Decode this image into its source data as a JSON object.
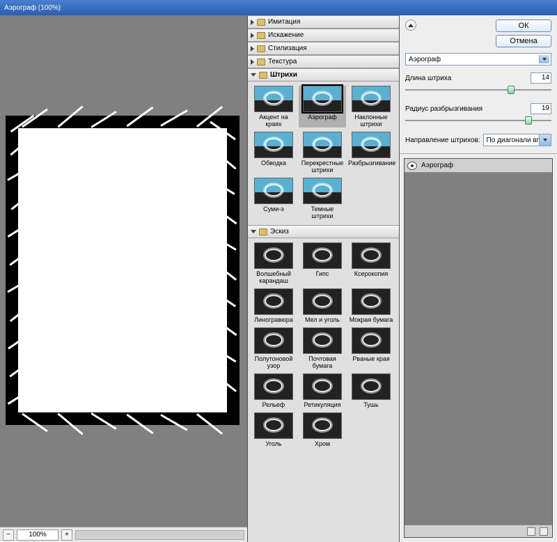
{
  "window": {
    "title": "Аэрограф (100%)"
  },
  "zoom": {
    "minus": "−",
    "value": "100%",
    "plus": "+"
  },
  "categories": [
    {
      "label": "Имитация",
      "open": false
    },
    {
      "label": "Искажение",
      "open": false
    },
    {
      "label": "Стилизация",
      "open": false
    },
    {
      "label": "Текстура",
      "open": false
    }
  ],
  "group_strokes": {
    "label": "Штрихи",
    "items": [
      {
        "label": "Акцент на краях"
      },
      {
        "label": "Аэрограф",
        "selected": true
      },
      {
        "label": "Наклонные штрихи"
      },
      {
        "label": "Обводка"
      },
      {
        "label": "Перекрестные штрихи"
      },
      {
        "label": "Разбрызгивание"
      },
      {
        "label": "Суми-э"
      },
      {
        "label": "Темные штрихи"
      }
    ]
  },
  "group_sketch": {
    "label": "Эскиз",
    "items": [
      {
        "label": "Волшебный карандаш"
      },
      {
        "label": "Гипс"
      },
      {
        "label": "Ксерокопия"
      },
      {
        "label": "Линогравюра"
      },
      {
        "label": "Мел и уголь"
      },
      {
        "label": "Мокрая бумага"
      },
      {
        "label": "Полутоновой узор"
      },
      {
        "label": "Почтовая бумага"
      },
      {
        "label": "Рваные края"
      },
      {
        "label": "Рельеф"
      },
      {
        "label": "Ретикуляция"
      },
      {
        "label": "Тушь"
      },
      {
        "label": "Уголь"
      },
      {
        "label": "Хром"
      }
    ]
  },
  "buttons": {
    "ok": "ОК",
    "cancel": "Отмена"
  },
  "filter_dropdown": "Аэрограф",
  "params": {
    "p1": {
      "label": "Длина штриха",
      "value": "14",
      "pos": 70
    },
    "p2": {
      "label": "Радиус разбрызгивания",
      "value": "19",
      "pos": 82
    }
  },
  "direction": {
    "label": "Направление штрихов:",
    "value": "По диагонали вправо"
  },
  "layer": {
    "name": "Аэрограф"
  }
}
